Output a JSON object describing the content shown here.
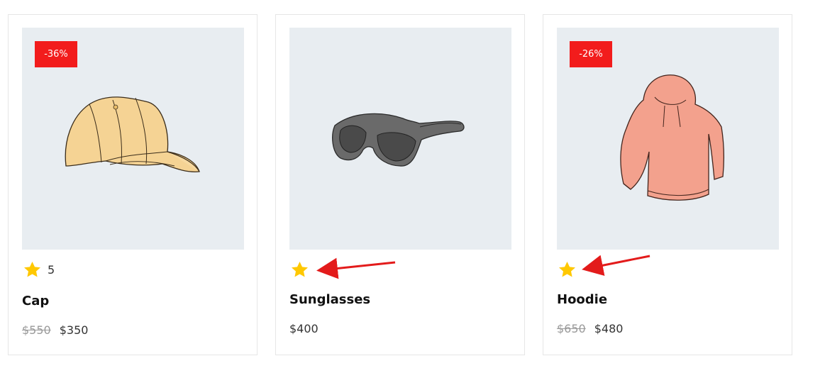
{
  "products": [
    {
      "discount": "-36%",
      "rating_count": "5",
      "title": "Cap",
      "old_price": "$550",
      "price": "$350",
      "image_icon": "cap-illustration"
    },
    {
      "title": "Sunglasses",
      "price": "$400",
      "image_icon": "sunglasses-illustration"
    },
    {
      "discount": "-26%",
      "title": "Hoodie",
      "old_price": "$650",
      "price": "$480",
      "image_icon": "hoodie-illustration"
    }
  ],
  "colors": {
    "badge": "#f21c1c",
    "star": "#ffc800",
    "image_bg": "#e8edf1",
    "annotation_arrow": "#e31b1b"
  }
}
